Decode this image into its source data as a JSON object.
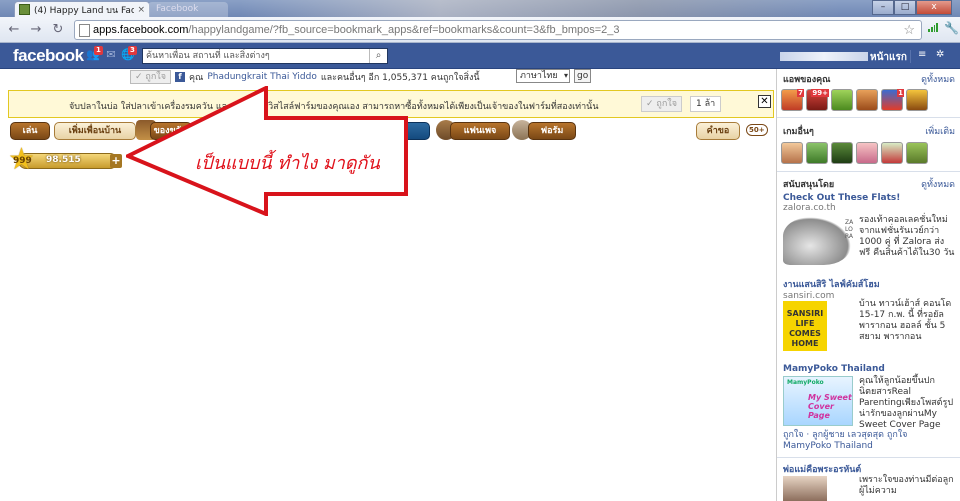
{
  "browser": {
    "tab_title": "(4) Happy Land บน Facebo",
    "tab_close": "×",
    "tab2_title": "Facebook",
    "url_domain": "apps.facebook.com",
    "url_path": "/happylandgame/?fb_source=bookmark_apps&ref=bookmarks&count=3&fb_bmpos=2_3",
    "win_min": "–",
    "win_max": "□",
    "win_close": "x"
  },
  "facebook": {
    "logo": "facebook",
    "friend_badge": "1",
    "notif_badge": "3",
    "search_placeholder": "ค้นหาเพื่อน สถานที่ และสิ่งต่างๆ",
    "home_label": "หน้าแรก",
    "account_icon": "≡",
    "settings_icon": "✲"
  },
  "like_bar": {
    "like_button": "✓ ถูกใจ",
    "text_before": "คุณ",
    "friend_name": "Phadungkrait Thai Yiddo",
    "text_after": "และคนอื่นๆ อีก 1,055,371 คนถูกใจสิ่งนี้",
    "language": "ภาษาไทย",
    "go": "go"
  },
  "banner": {
    "text": "จับปลาในบ่อ ใส่ปลาเข้าเครื่องรมควัน และเยี่ยมในควิสไสล์ฟาร์มของคุณเอง สามารถหาซื้อทั้งหมดได้เพียงเป็นเจ้าของในฟาร์มที่สองเท่านั้น",
    "like_button": "✓ ถูกใจ",
    "like_count": "1 ล้า",
    "close": "✕"
  },
  "game_nav": {
    "play": "เล่น",
    "add_friends": "เพิ่มเพื่อนบ้าน",
    "gifts": "ของขวัญ",
    "fan_page": "แฟนเพจ",
    "forum": "ฟอรัม",
    "help": "คำขอ",
    "help_badge": "50+"
  },
  "resources": {
    "level": "999",
    "coins": "98.515",
    "add": "+"
  },
  "annotation": {
    "text": "เป็นแบบนี้ ทำไง มาดูกัน"
  },
  "sidebar": {
    "apps_title": "แอพของคุณ",
    "apps_link": "ดูทั้งหมด",
    "app_badges": [
      "7",
      "99+",
      "",
      "",
      "1",
      ""
    ],
    "games_title": "เกมอื่นๆ",
    "games_link": "เพิ่มเติม",
    "sponsored_title": "สนับสนุนโดย",
    "sponsored_link": "ดูทั้งหมด",
    "ads": [
      {
        "title": "Check Out These Flats!",
        "domain": "zalora.co.th",
        "body": "รองเท้าคอลเลคชั่นใหม่ จากแฟชั่นรันเวย์กว่า 1000 คู่ ที่ Zalora ส่งฟรี คืนสินค้าได้ใน30 วัน",
        "brand": "ZALORA"
      },
      {
        "title": "งานแสนสิริ ไลฟ์คัมส์โฮม",
        "domain": "sansiri.com",
        "body": "บ้าน ทาวน์เฮ้าส์ คอนโด 15-17 ก.พ. นี้ ที่รอยัล พารากอน ฮอลล์ ชั้น 5 สยาม พารากอน",
        "image_text": "SANSIRI LIFE COMES HOME"
      },
      {
        "title": "MamyPoko Thailand",
        "domain": "",
        "body": "คุณให้ลูกน้อยขึ้นปกนิตยสารReal Parentingเพียงโพสต์รูปน่ารักของลูกผ่านMy Sweet Cover Page",
        "image_logo": "MamyPoko",
        "image_text": "My Sweet Cover Page",
        "social": "ถูกใจ · ลูกผู้ชาย เลวสุดสุด ถูกใจ MamyPoko Thailand"
      },
      {
        "title": "พ่อแม่คือพระอรหันต์",
        "domain": "",
        "body": "เพราะใจของท่านมีต่อลูกผู้ไม่ความ"
      }
    ]
  }
}
